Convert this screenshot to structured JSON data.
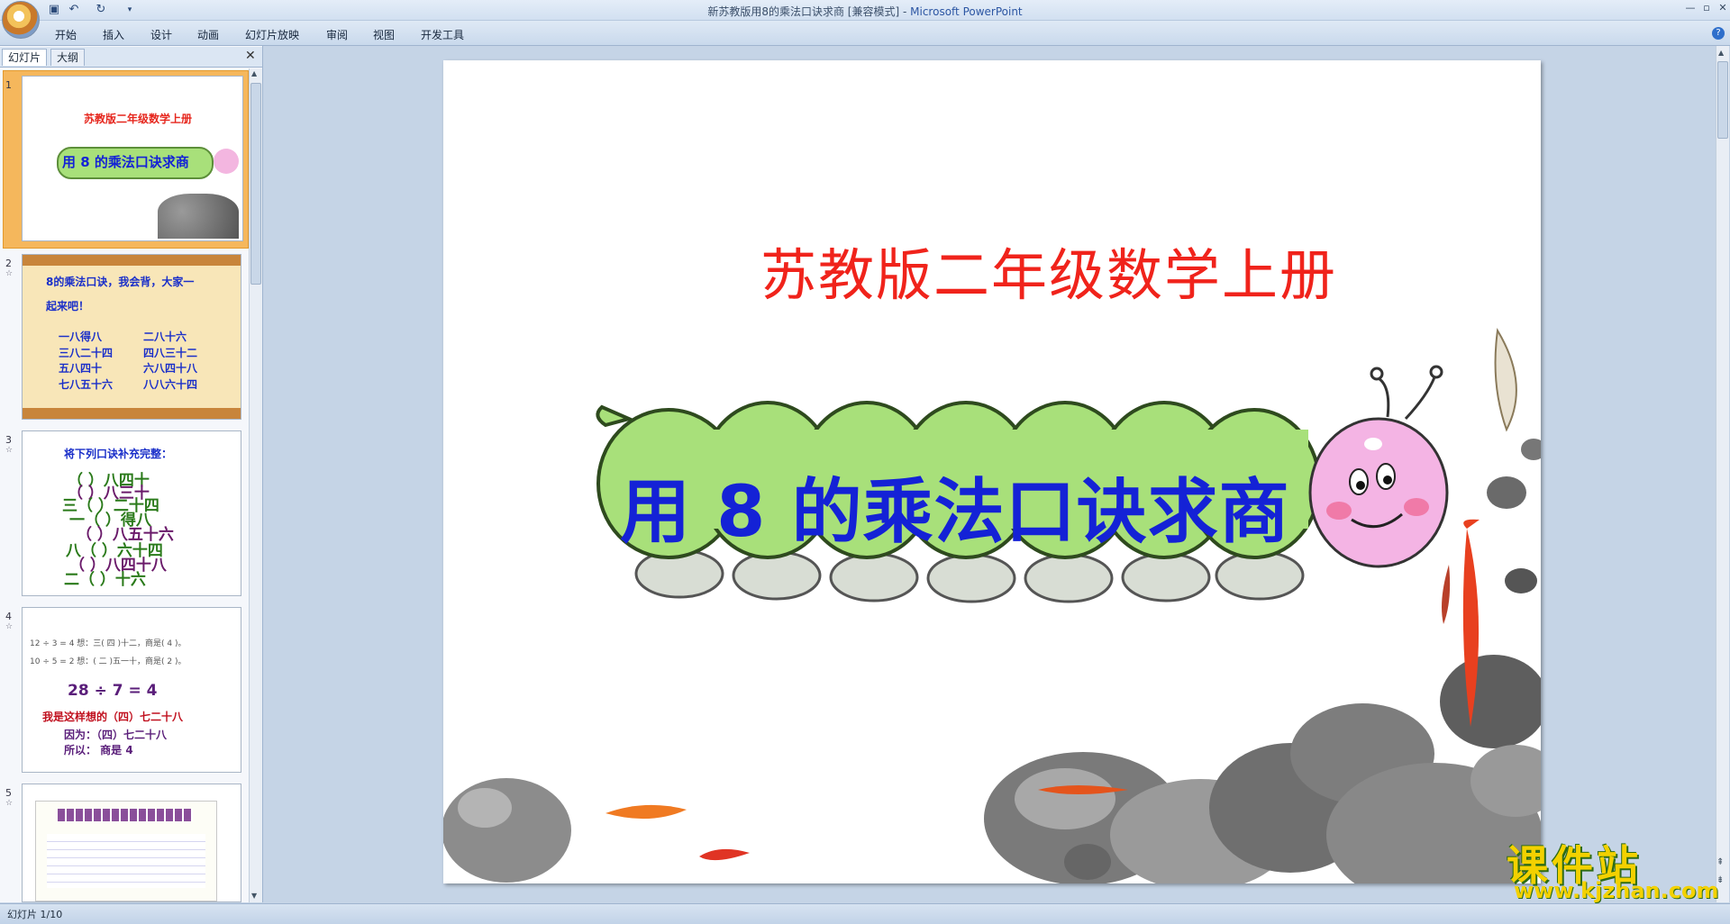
{
  "window": {
    "title": "新苏教版用8的乘法口诀求商 [兼容模式] - ",
    "app": "Microsoft PowerPoint"
  },
  "ribbon": {
    "tabs": [
      "开始",
      "插入",
      "设计",
      "动画",
      "幻灯片放映",
      "审阅",
      "视图",
      "开发工具"
    ]
  },
  "left_pane": {
    "tabs": [
      "幻灯片",
      "大纲"
    ],
    "thumbnails": [
      {
        "num": "1",
        "line1": "苏教版二年级数学上册",
        "line2": "用 8 的乘法口诀求商"
      },
      {
        "num": "2",
        "line1": "8的乘法口诀，我会背，大家一",
        "line2": "起来吧！",
        "rows": [
          [
            "一八得八",
            "二八十六"
          ],
          [
            "三八二十四",
            "四八三十二"
          ],
          [
            "五八四十",
            "六八四十八"
          ],
          [
            "七八五十六",
            "八八六十四"
          ]
        ]
      },
      {
        "num": "3",
        "line1": "将下列口诀补充完整：",
        "rows": [
          "（  ）八四十",
          "（  ）八三十",
          "三（  ）二十四",
          "一（  ）得八",
          "（  ）八五十六",
          "八（  ）六十四",
          "（  ）八四十八",
          "二（  ）十六"
        ]
      },
      {
        "num": "4",
        "row1": "12 ÷ 3 = 4    想：三( 四 )十二，商是( 4 )。",
        "row2": "10 ÷ 5 = 2    想：( 二 )五一十，商是( 2 )。",
        "eq": "28  ÷  7  = 4",
        "line1": "我是这样想的（四）七二十八",
        "line2": "因为：（四）七二十八",
        "line3": "所以：  商是 4"
      },
      {
        "num": "5"
      }
    ]
  },
  "slide": {
    "subtitle": "苏教版二年级数学上册",
    "title": "用 8 的乘法口诀求商"
  },
  "watermark": {
    "text": "课件站",
    "url": "www.kjzhan.com"
  },
  "status": {
    "text": "幻灯片 1/10"
  },
  "colors": {
    "subtitle": "#f0231b",
    "title": "#1422d6",
    "caterpillar": "#a8e07a",
    "workspace": "#c5d4e6"
  }
}
